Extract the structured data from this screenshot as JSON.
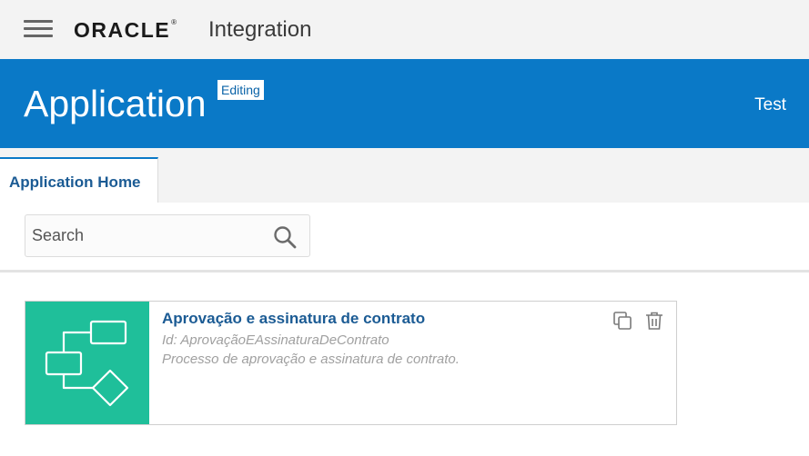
{
  "header": {
    "brand": "ORACLE",
    "registered_mark": "®",
    "product": "Integration"
  },
  "banner": {
    "title": "Application",
    "badge": "Editing",
    "right_text": "Test"
  },
  "tabs": [
    {
      "label": "Application Home",
      "active": true
    }
  ],
  "search": {
    "placeholder": "Search",
    "value": ""
  },
  "cards": [
    {
      "title": "Aprovação e assinatura de contrato",
      "id_text": "Id: AprovaçãoEAssinaturaDeContrato",
      "description": "Processo de aprovação e assinatura de contrato.",
      "thumbnail_icon": "process-flow-icon",
      "actions": [
        "copy-icon",
        "trash-icon"
      ]
    }
  ],
  "colors": {
    "banner": "#0a79c7",
    "thumbnail": "#1fbf9a",
    "link": "#1b5b94",
    "topbar": "#f3f3f3"
  }
}
